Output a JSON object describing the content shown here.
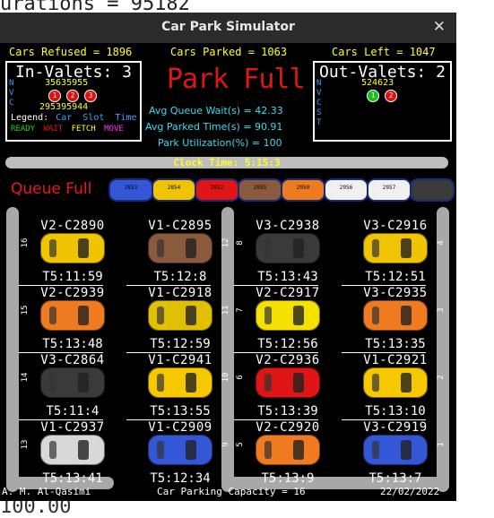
{
  "background": {
    "top_text": "urations = 95182",
    "bottom_text": "100.00"
  },
  "window": {
    "title": "Car Park Simulator",
    "close_icon": "close-icon"
  },
  "stats": {
    "cars_refused": "Cars Refused = 1896",
    "cars_parked": "Cars Parked = 1063",
    "cars_left": "Cars Left = 1047"
  },
  "in_valets": {
    "title": "In-Valets: 3",
    "row_labels": [
      "N",
      "V",
      "C"
    ],
    "row_n": "35635955",
    "row_c": "295395944",
    "dots": [
      {
        "label": "1"
      },
      {
        "label": "2"
      },
      {
        "label": "3"
      }
    ],
    "legend_label": "Legend:",
    "legend_items": [
      "Car",
      "Slot",
      "Time"
    ],
    "states": [
      {
        "label": "READY",
        "color": "#18d018"
      },
      {
        "label": "WAIT",
        "color": "#e01818"
      },
      {
        "label": "FETCH",
        "color": "#ffff22"
      },
      {
        "label": "MOVE",
        "color": "#ff33ff"
      }
    ]
  },
  "park_full": "Park Full",
  "metrics": {
    "avg_queue_wait": "Avg Queue Wait(s) =  42.33",
    "avg_parked_time": "Avg Parked Time(s) =  90.91",
    "park_utilization": "Park Utilization(%) = 100"
  },
  "out_valets": {
    "title": "Out-Valets: 2",
    "row_labels": [
      "N",
      "V",
      "C",
      "S",
      "T"
    ],
    "row_n": "524623",
    "dots": [
      {
        "label": "1",
        "status": "ready"
      },
      {
        "label": "2",
        "status": "wait"
      }
    ]
  },
  "clock": "Clock Time: 5:15:3",
  "queue": {
    "label": "Queue Full",
    "cars": [
      {
        "color": "#3357d6",
        "label": "2853"
      },
      {
        "color": "#f0c400",
        "label": "2854"
      },
      {
        "color": "#e01515",
        "label": "2952"
      },
      {
        "color": "#8a5a3c",
        "label": "2955"
      },
      {
        "color": "#f07a20",
        "label": "2950"
      },
      {
        "color": "#f0f0f0",
        "label": "2956"
      },
      {
        "color": "#f0f0f0",
        "label": "2957"
      },
      {
        "color": "#3a3a3a",
        "label": ""
      }
    ]
  },
  "slots": [
    {
      "id": "V2-C2890",
      "time": "T5:11:59",
      "num": "16",
      "color": "#f0c400"
    },
    {
      "id": "V1-C2895",
      "time": "T5:12:8",
      "num": "12",
      "color": "#8a5a3c"
    },
    {
      "id": "V3-C2938",
      "time": "T5:13:43",
      "num": "8",
      "color": "#3a3a3a"
    },
    {
      "id": "V3-C2916",
      "time": "T5:12:51",
      "num": "4",
      "color": "#f0c400"
    },
    {
      "id": "V2-C2939",
      "time": "T5:13:48",
      "num": "15",
      "color": "#f07a20"
    },
    {
      "id": "V1-C2918",
      "time": "T5:12:59",
      "num": "11",
      "color": "#e0c000"
    },
    {
      "id": "V2-C2917",
      "time": "T5:12:56",
      "num": "7",
      "color": "#f5e000"
    },
    {
      "id": "V3-C2935",
      "time": "T5:13:35",
      "num": "3",
      "color": "#f07a20"
    },
    {
      "id": "V3-C2864",
      "time": "T5:11:4",
      "num": "14",
      "color": "#3a3a3a"
    },
    {
      "id": "V1-C2941",
      "time": "T5:13:55",
      "num": "10",
      "color": "#f5c800"
    },
    {
      "id": "V2-C2936",
      "time": "T5:13:39",
      "num": "6",
      "color": "#e01515"
    },
    {
      "id": "V1-C2921",
      "time": "T5:13:10",
      "num": "2",
      "color": "#f5c800"
    },
    {
      "id": "V1-C2937",
      "time": "T5:13:41",
      "num": "13",
      "color": "#d8d8d8"
    },
    {
      "id": "V1-C2909",
      "time": "T5:12:34",
      "num": "9",
      "color": "#3357d6"
    },
    {
      "id": "V2-C2920",
      "time": "T5:13:9",
      "num": "5",
      "color": "#f07a20"
    },
    {
      "id": "V3-C2919",
      "time": "T5:13:7",
      "num": "1",
      "color": "#3357d6"
    }
  ],
  "footer": {
    "author": "A. M. Al-Qasimi",
    "capacity": "Car Parking Capacity = 16",
    "date": "22/02/2022"
  }
}
